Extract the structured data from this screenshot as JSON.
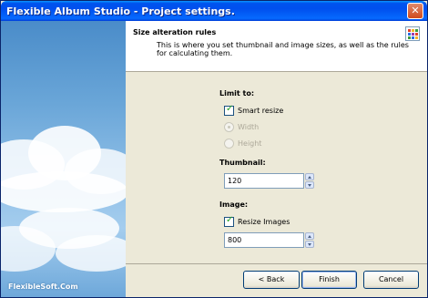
{
  "window": {
    "title": "Flexible Album Studio - Project settings.",
    "close_glyph": "✕"
  },
  "sidebar": {
    "brand": "FlexibleSoft.Com"
  },
  "header": {
    "title": "Size alteration rules",
    "description": "This is where you set thumbnail and image sizes, as well as the rules for calculating them.",
    "icon": "grid-icon"
  },
  "limit": {
    "label": "Limit to:",
    "smart_resize": {
      "label": "Smart resize",
      "checked": true
    },
    "width": {
      "label": "Width",
      "selected": true,
      "enabled": false
    },
    "height": {
      "label": "Height",
      "selected": false,
      "enabled": false
    }
  },
  "thumbnail": {
    "label": "Thumbnail:",
    "value": "120"
  },
  "image": {
    "label": "Image:",
    "resize_images": {
      "label": "Resize Images",
      "checked": true
    },
    "value": "800"
  },
  "buttons": {
    "back": "< Back",
    "finish": "Finish",
    "cancel": "Cancel"
  },
  "colors": {
    "titlebar": "#0053ee",
    "dialog_bg": "#ece9d8",
    "check": "#21a121"
  }
}
